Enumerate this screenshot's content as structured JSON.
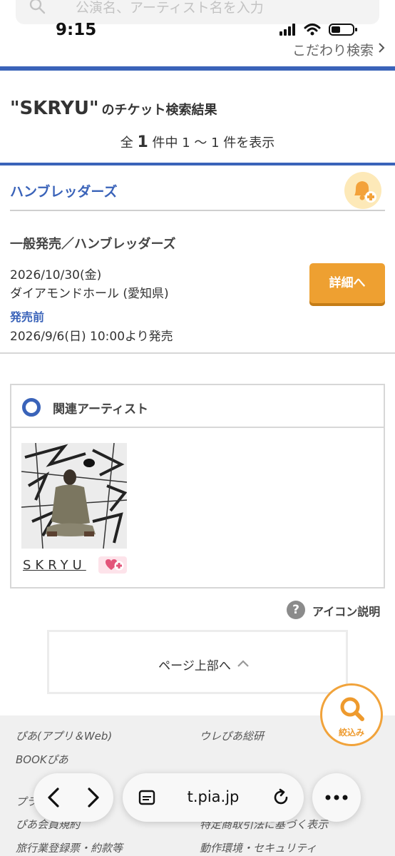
{
  "status_bar": {
    "time": "9:15"
  },
  "search": {
    "placeholder": "公演名、アーティスト名を入力"
  },
  "header": {
    "kodawari_link": "こだわり検索"
  },
  "results": {
    "query": "\"SKRYU\"",
    "title_suffix": "のチケット検索結果",
    "count_prefix": "全",
    "count_total": "1",
    "count_suffix": "件中 1 〜 1 件を表示"
  },
  "event": {
    "troupe": "ハンブレッダーズ",
    "sale_type": "一般発売／ハンブレッダーズ",
    "performance_date": "2026/10/30(金)",
    "venue": "ダイアモンドホール (愛知県)",
    "status": "発売前",
    "sale_date": "2026/9/6(日) 10:00より発売",
    "detail_button": "詳細へ"
  },
  "related_artists": {
    "label": "関連アーティスト",
    "items": [
      {
        "name": "SKRYU"
      }
    ]
  },
  "help": {
    "label": "アイコン説明",
    "icon": "question-icon"
  },
  "pagetop": {
    "label": "ページ上部へ"
  },
  "footer": {
    "links": [
      "ぴあ(アプリ＆Web)",
      "ウレぴあ総研",
      "BOOKぴあ",
      "プラ",
      "ぴあ会員規約",
      "特定商取引法に基づく表示",
      "旅行業登録票・約款等",
      "動作環境・セキュリティ"
    ]
  },
  "fab": {
    "label": "絞込み"
  },
  "browser": {
    "url": "t.pia.jp"
  },
  "colors": {
    "accent_blue": "#3a63b9",
    "button_orange": "#eea031",
    "fab_orange": "#f1a33b"
  }
}
